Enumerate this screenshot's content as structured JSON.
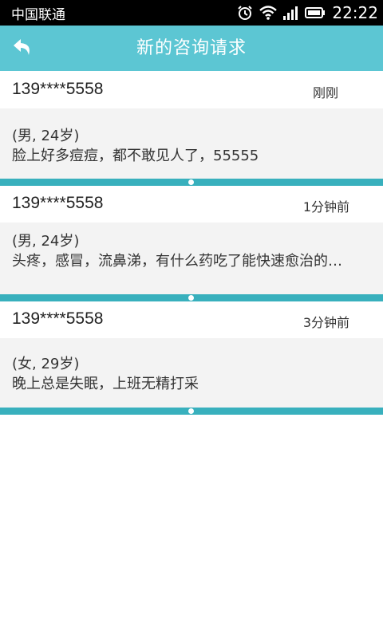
{
  "status_bar": {
    "carrier": "中国联通",
    "time": "22:22",
    "icons": [
      "alarm-icon",
      "wifi-icon",
      "signal-icon",
      "battery-icon"
    ]
  },
  "header": {
    "title": "新的咨询请求",
    "back_icon": "back-arrow-icon",
    "background": "#5cc6d3"
  },
  "requests": [
    {
      "phone": "139****5558",
      "time": "刚刚",
      "info": "(男, 24岁)",
      "message": "脸上好多痘痘，都不敢见人了，55555"
    },
    {
      "phone": "139****5558",
      "time": "1分钟前",
      "info": "(男, 24岁)",
      "message": "头疼，感冒，流鼻涕，有什么药吃了能快速愈治的…"
    },
    {
      "phone": "139****5558",
      "time": "3分钟前",
      "info": "(女, 29岁)",
      "message": "晚上总是失眠，上班无精打采"
    }
  ],
  "colors": {
    "separator": "#38b0bd",
    "card_body": "#f3f3f3"
  }
}
